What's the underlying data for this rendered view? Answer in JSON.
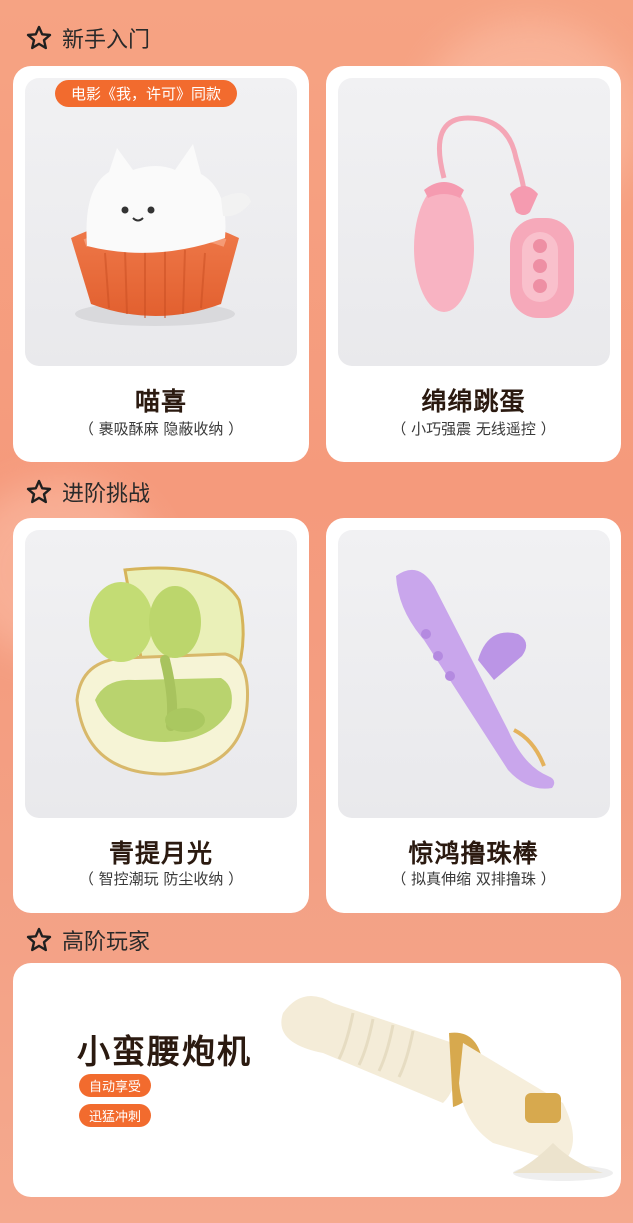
{
  "sections": [
    {
      "title": "新手入门"
    },
    {
      "title": "进阶挑战"
    },
    {
      "title": "高阶玩家"
    }
  ],
  "products": [
    {
      "badge": "电影《我，许可》同款",
      "name": "喵喜",
      "desc": "（ 裹吸酥麻 隐蔽收纳 ）"
    },
    {
      "name": "绵绵跳蛋",
      "desc": "（ 小巧强震 无线遥控 ）"
    },
    {
      "name": "青提月光",
      "desc": "（ 智控潮玩 防尘收纳 ）"
    },
    {
      "name": "惊鸿撸珠棒",
      "desc": "（ 拟真伸缩 双排撸珠 ）"
    }
  ],
  "featured": {
    "name": "小蛮腰炮机",
    "tags": [
      "自动享受",
      "迅猛冲刺"
    ]
  },
  "colors": {
    "accent": "#f26b2e",
    "background": "#f59a7c"
  }
}
